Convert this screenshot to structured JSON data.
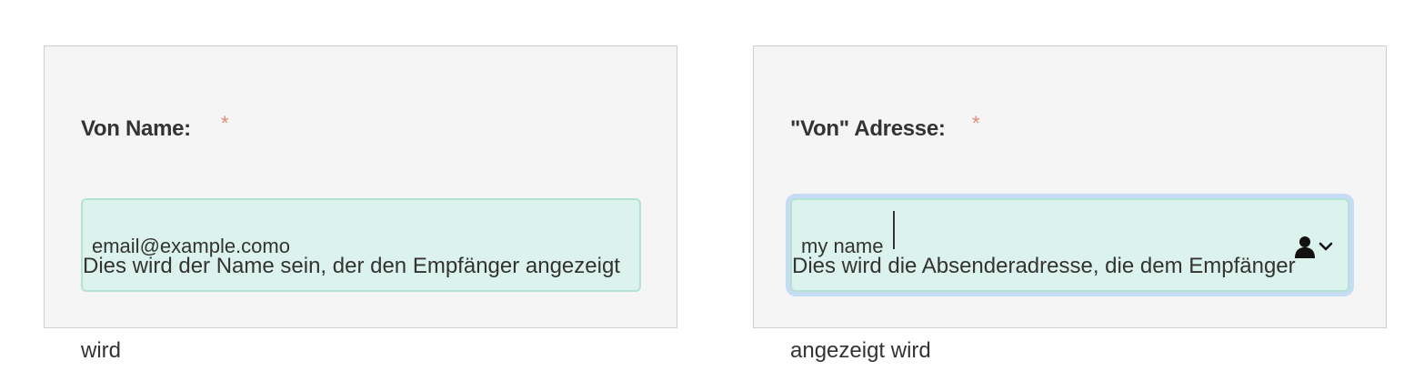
{
  "left_field": {
    "label": "Von Name:",
    "required_mark": "*",
    "value": "email@example.como",
    "help_line1": "Dies wird der Name sein, der den Empfänger angezeigt",
    "help_line2": "wird"
  },
  "right_field": {
    "label": "\"Von\" Adresse:",
    "required_mark": "*",
    "value": "my name",
    "icon": "contact-dropdown-icon",
    "help_line1": "Dies wird die Absenderadresse, die dem Empfänger",
    "help_line2": "angezeigt wird"
  },
  "colors": {
    "required": "#e08a78",
    "input_background": "#dcf2ec",
    "focus_ring": "#c4ddf5"
  }
}
